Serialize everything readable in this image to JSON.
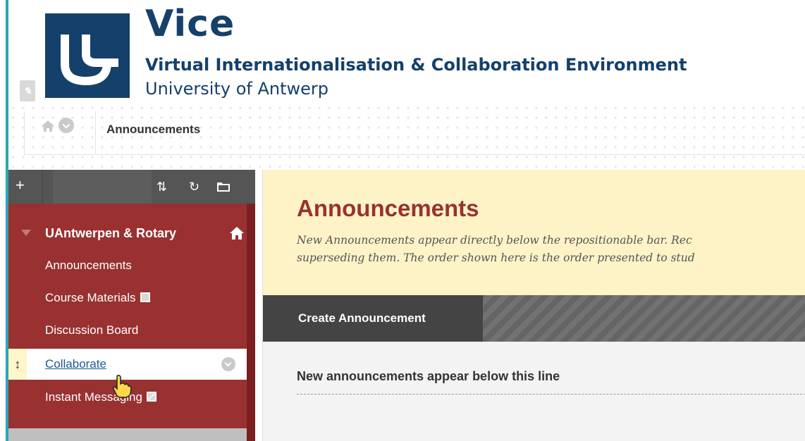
{
  "header": {
    "brand_title": "Vice",
    "brand_subtitle": "Virtual Internationalisation & Collaboration Environment",
    "university": "University of Antwerp"
  },
  "breadcrumb": {
    "current": "Announcements"
  },
  "sidebar": {
    "course_title": "UAntwerpen & Rotary",
    "items": [
      {
        "label": "Announcements"
      },
      {
        "label": "Course Materials"
      },
      {
        "label": "Discussion Board"
      },
      {
        "label": "Collaborate"
      },
      {
        "label": "Instant Messaging"
      }
    ]
  },
  "main": {
    "title": "Announcements",
    "description_line1": "New Announcements appear directly below the repositionable bar. Rec",
    "description_line2": "superseding them. The order shown here is the order presented to stud",
    "create_button": "Create Announcement",
    "new_line_text": "New announcements appear below this line"
  },
  "colors": {
    "brand_blue": "#14406b",
    "sidebar_red": "#993131",
    "hero_yellow": "#fdf3c7",
    "link_blue": "#1a5a96"
  },
  "icons": [
    "home-icon",
    "chevron-down-icon",
    "plus-icon",
    "sort-icon",
    "refresh-icon",
    "folder-icon",
    "drag-handle-icon",
    "hand-cursor-icon"
  ]
}
